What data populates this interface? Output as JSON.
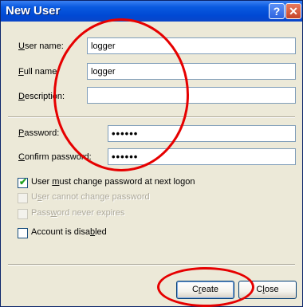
{
  "window": {
    "title": "New User",
    "help_label": "?",
    "close_label": "✕"
  },
  "form": {
    "user_name": {
      "label_u": "U",
      "label_rest": "ser name:",
      "value": "logger"
    },
    "full_name": {
      "label_u": "F",
      "label_rest": "ull name:",
      "value": "logger"
    },
    "description": {
      "label_u": "D",
      "label_rest": "escription:",
      "value": ""
    },
    "password": {
      "label_u": "P",
      "label_rest": "assword:",
      "value": "••••••"
    },
    "confirm_password": {
      "label_u": "C",
      "label_rest": "onfirm password:",
      "value": "••••••"
    }
  },
  "options": [
    {
      "pre": "User ",
      "u": "m",
      "post": "ust change password at next logon",
      "checked": true,
      "enabled": true
    },
    {
      "pre": "U",
      "u": "s",
      "post": "er cannot change password",
      "checked": false,
      "enabled": false
    },
    {
      "pre": "Pass",
      "u": "w",
      "post": "ord never expires",
      "checked": false,
      "enabled": false
    },
    {
      "pre": "Account is disa",
      "u": "b",
      "post": "led",
      "checked": false,
      "enabled": true
    }
  ],
  "buttons": {
    "create_u": "r",
    "create_pre": "C",
    "create_post": "eate",
    "close_u": "l",
    "close_pre": "C",
    "close_post": "ose"
  },
  "colors": {
    "titlebar": "#0a5ae0",
    "dialog_bg": "#ece9d8",
    "annotation": "#e60000"
  }
}
